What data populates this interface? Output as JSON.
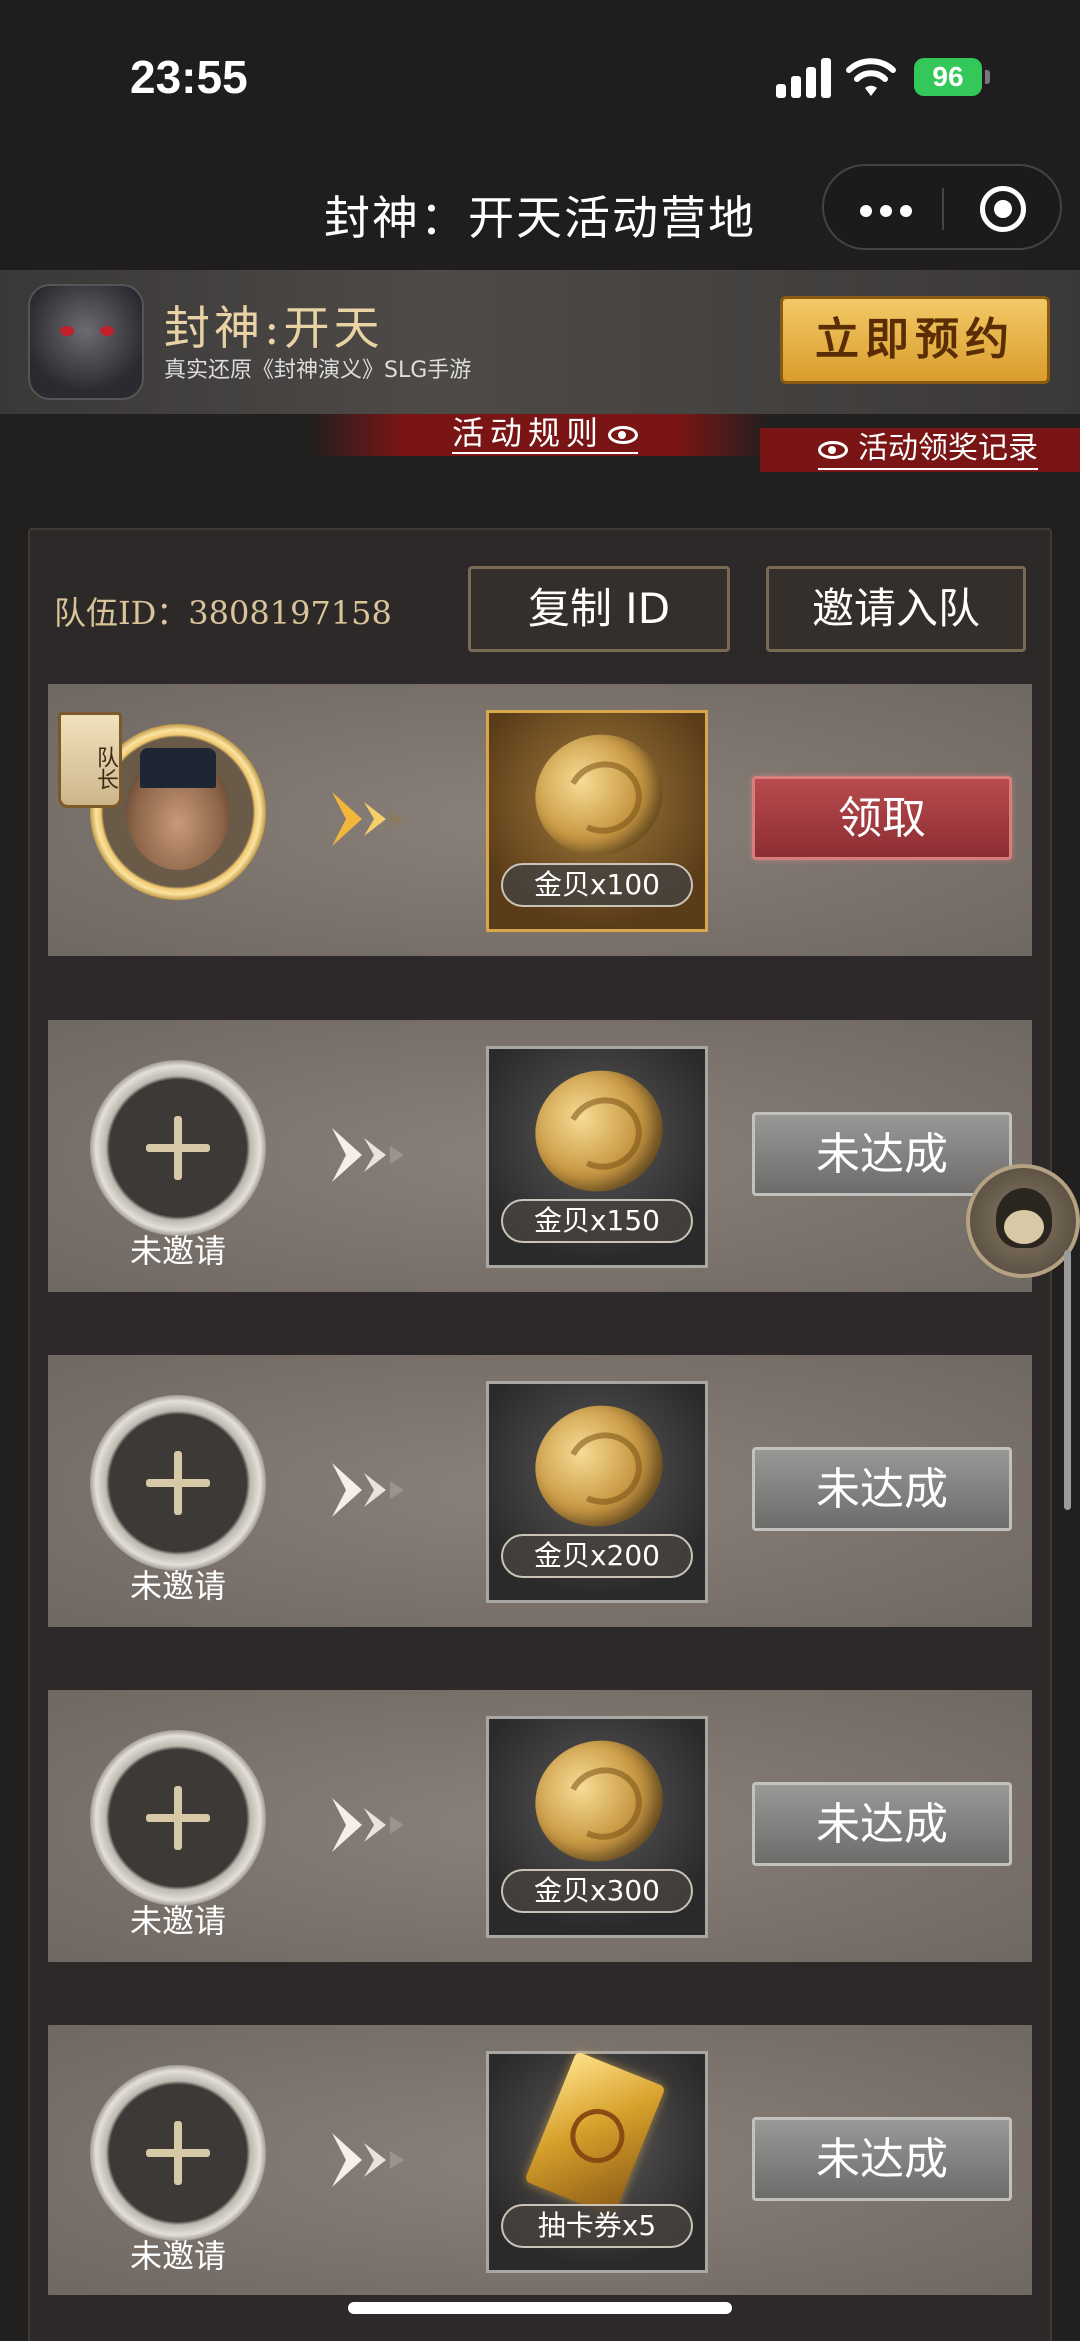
{
  "status_bar": {
    "time": "23:55",
    "battery": "96"
  },
  "nav": {
    "title": "封神：开天活动营地"
  },
  "banner": {
    "game_title": "封神:开天",
    "subtitle": "真实还原《封神演义》SLG手游",
    "reserve_button": "立即预约"
  },
  "links": {
    "rules": "活动规则",
    "records": "活动领奖记录"
  },
  "team": {
    "id_text": "队伍ID：3808197158",
    "copy_button": "复制 ID",
    "invite_button": "邀请入队"
  },
  "rows": [
    {
      "leader_badge": "队长",
      "reward": "金贝x100",
      "action": "领取"
    },
    {
      "label": "未邀请",
      "reward": "金贝x150",
      "action": "未达成"
    },
    {
      "label": "未邀请",
      "reward": "金贝x200",
      "action": "未达成"
    },
    {
      "label": "未邀请",
      "reward": "金贝x300",
      "action": "未达成"
    },
    {
      "label": "未邀请",
      "reward": "抽卡券x5",
      "action": "未达成"
    }
  ],
  "colors": {
    "accent_gold": "#d9c49a",
    "claim_red": "#8c2d33",
    "banner_red": "#7a1515"
  }
}
